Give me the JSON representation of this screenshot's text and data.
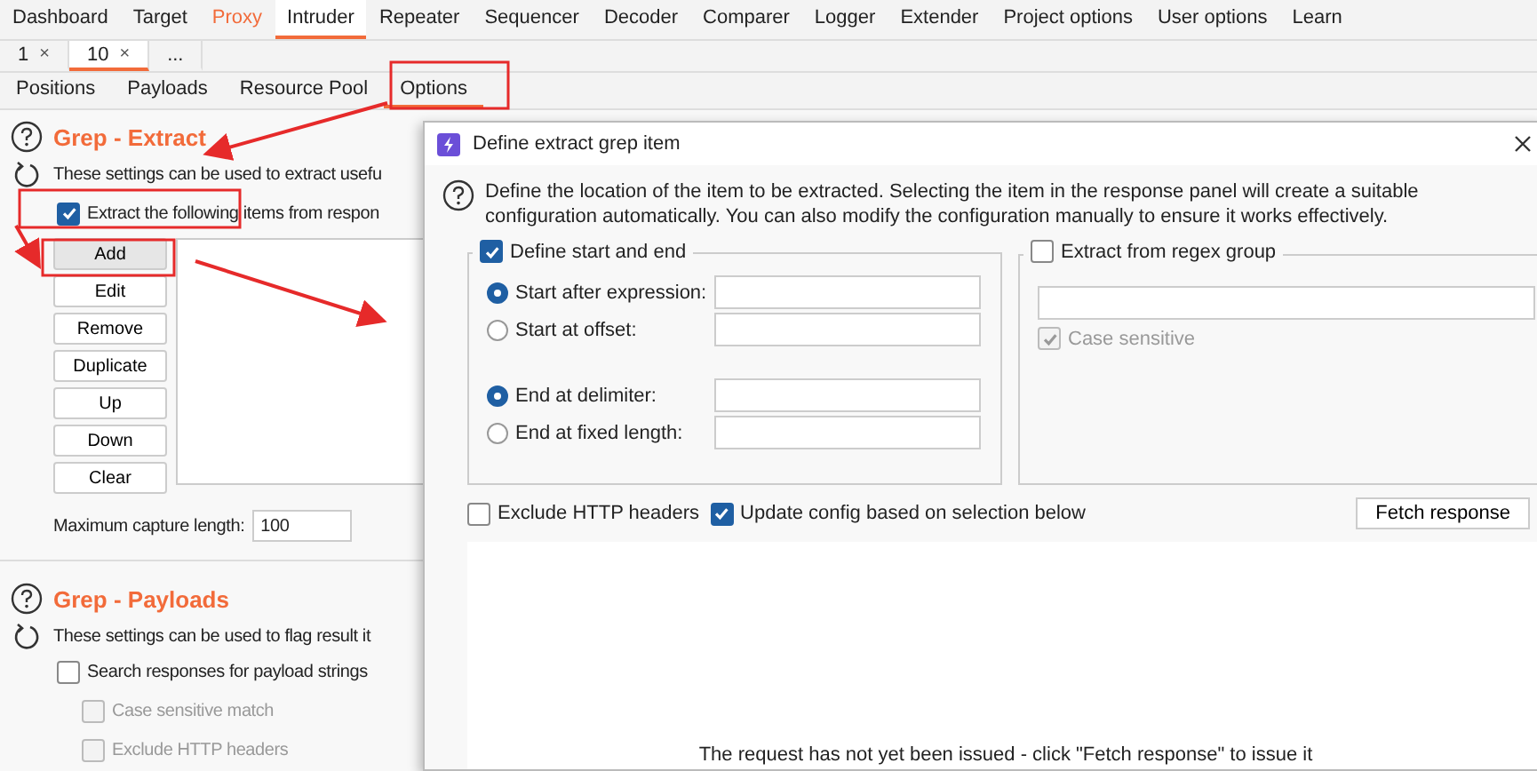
{
  "menu_tabs": [
    {
      "label": "Dashboard",
      "selected": false,
      "highlighted": false
    },
    {
      "label": "Target",
      "selected": false,
      "highlighted": false
    },
    {
      "label": "Proxy",
      "selected": false,
      "highlighted": true
    },
    {
      "label": "Intruder",
      "selected": true,
      "highlighted": false
    },
    {
      "label": "Repeater",
      "selected": false,
      "highlighted": false
    },
    {
      "label": "Sequencer",
      "selected": false,
      "highlighted": false
    },
    {
      "label": "Decoder",
      "selected": false,
      "highlighted": false
    },
    {
      "label": "Comparer",
      "selected": false,
      "highlighted": false
    },
    {
      "label": "Logger",
      "selected": false,
      "highlighted": false
    },
    {
      "label": "Extender",
      "selected": false,
      "highlighted": false
    },
    {
      "label": "Project options",
      "selected": false,
      "highlighted": false
    },
    {
      "label": "User options",
      "selected": false,
      "highlighted": false
    },
    {
      "label": "Learn",
      "selected": false,
      "highlighted": false
    }
  ],
  "attack_tabs": [
    {
      "label": "1",
      "close": "×",
      "selected": false
    },
    {
      "label": "10",
      "close": "×",
      "selected": true
    }
  ],
  "new_tab": "...",
  "sub_tabs": [
    {
      "label": "Positions",
      "selected": false
    },
    {
      "label": "Payloads",
      "selected": false
    },
    {
      "label": "Resource Pool",
      "selected": false
    },
    {
      "label": "Options",
      "selected": true
    }
  ],
  "grep_extract": {
    "title": "Grep - Extract",
    "description": "These settings can be used to extract usefu",
    "extract_checkbox": {
      "label": "Extract the following items from respon",
      "checked": true
    },
    "buttons": [
      {
        "label": "Add",
        "selected": true
      },
      {
        "label": "Edit",
        "selected": false
      },
      {
        "label": "Remove",
        "selected": false
      },
      {
        "label": "Duplicate",
        "selected": false
      },
      {
        "label": "Up",
        "selected": false
      },
      {
        "label": "Down",
        "selected": false
      },
      {
        "label": "Clear",
        "selected": false
      }
    ],
    "max_capture": {
      "label": "Maximum capture length:",
      "value": "100"
    }
  },
  "grep_payloads": {
    "title": "Grep - Payloads",
    "description": "These settings can be used to flag result it",
    "options": [
      {
        "label": "Search responses for payload strings",
        "checked": false,
        "disabled": false
      },
      {
        "label": "Case sensitive match",
        "checked": false,
        "disabled": true
      },
      {
        "label": "Exclude HTTP headers",
        "checked": false,
        "disabled": true
      }
    ]
  },
  "dialog": {
    "title": "Define extract grep item",
    "description": "Define the location of the item to be extracted. Selecting the item in the response panel will create a suitable configuration automatically. You can also modify the configuration manually to ensure it works effectively.",
    "start_end_group": {
      "label": "Define start and end",
      "checked": true,
      "start_options": [
        {
          "label": "Start after expression:",
          "selected": true
        },
        {
          "label": "Start at offset:",
          "selected": false
        }
      ],
      "end_options": [
        {
          "label": "End at delimiter:",
          "selected": true
        },
        {
          "label": "End at fixed length:",
          "selected": false
        }
      ]
    },
    "regex_group": {
      "label": "Extract from regex group",
      "checked": false,
      "case_sensitive": {
        "label": "Case sensitive",
        "checked": true,
        "disabled": true
      }
    },
    "options": [
      {
        "label": "Exclude HTTP headers",
        "checked": false
      },
      {
        "label": "Update config based on selection below",
        "checked": true
      }
    ],
    "fetch_button": "Fetch response",
    "response_message": "The request has not yet been issued - click \"Fetch response\" to issue it"
  }
}
